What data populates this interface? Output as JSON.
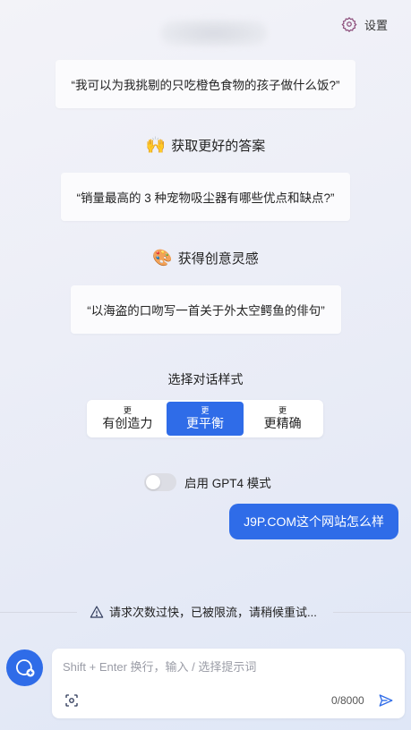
{
  "header": {
    "settings_label": "设置"
  },
  "prompts": [
    {
      "text": "“我可以为我挑剔的只吃橙色食物的孩子做什么饭?”"
    },
    {
      "text": "“销量最高的 3 种宠物吸尘器有哪些优点和缺点?”"
    },
    {
      "text": "“以海盗的口吻写一首关于外太空鳄鱼的俳句”"
    }
  ],
  "sections": [
    {
      "emoji": "🙌",
      "title": "获取更好的答案"
    },
    {
      "emoji": "🎨",
      "title": "获得创意灵感"
    }
  ],
  "style_selector": {
    "label": "选择对话样式",
    "options": [
      {
        "pre": "更",
        "main": "有创造力",
        "active": false
      },
      {
        "pre": "更",
        "main": "更平衡",
        "active": true
      },
      {
        "pre": "更",
        "main": "更精确",
        "active": false
      }
    ]
  },
  "gpt4": {
    "label": "启用 GPT4 模式",
    "enabled": false
  },
  "chat": {
    "user_message": "J9P.COM这个网站怎么样"
  },
  "warning": {
    "text": "请求次数过快，已被限流，请稍候重试..."
  },
  "input": {
    "placeholder": "Shift + Enter 换行，输入 / 选择提示词",
    "value": "",
    "counter": "0/8000"
  },
  "colors": {
    "accent": "#2f6ce8",
    "settings_icon": "#8a4a78"
  }
}
